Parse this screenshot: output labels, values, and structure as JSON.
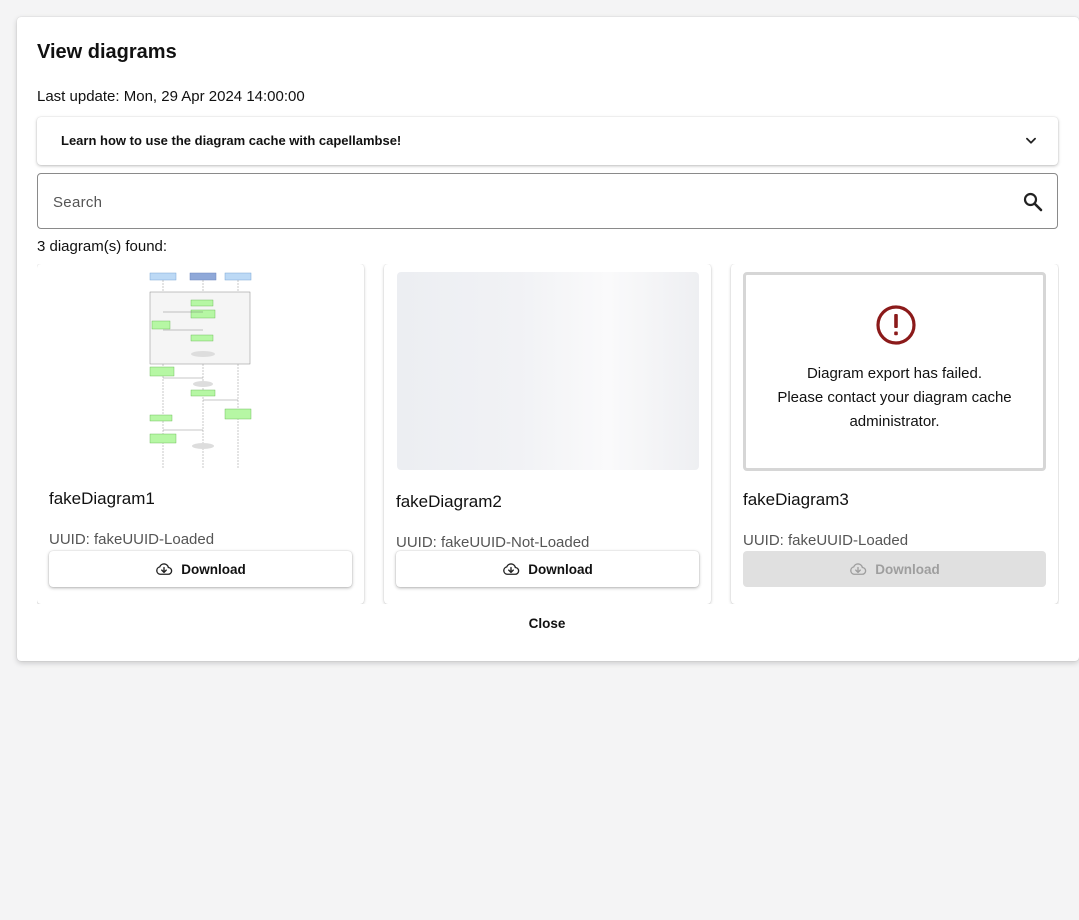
{
  "dialog": {
    "title": "View diagrams",
    "last_update": "Last update: Mon, 29 Apr 2024 14:00:00",
    "accordion_label": "Learn how to use the diagram cache with capellambse!",
    "search_placeholder": "Search",
    "found_text": "3 diagram(s) found:",
    "close_label": "Close"
  },
  "diagrams": [
    {
      "name": "fakeDiagram1",
      "uuid": "UUID: fakeUUID-Loaded",
      "state": "loaded",
      "download_label": "Download"
    },
    {
      "name": "fakeDiagram2",
      "uuid": "UUID: fakeUUID-Not-Loaded",
      "state": "loading",
      "download_label": "Download"
    },
    {
      "name": "fakeDiagram3",
      "uuid": "UUID: fakeUUID-Loaded",
      "state": "failed",
      "download_label": "Download",
      "error_line1": "Diagram export has failed.",
      "error_line2": "Please contact your diagram cache administrator."
    }
  ],
  "colors": {
    "error_red": "#8b1a1a",
    "disabled_bg": "#e0e0e0",
    "thumb_green": "#b6f7a4",
    "thumb_blue": "#bcd9f5"
  },
  "icons": {
    "expand": "chevron-down-icon",
    "search": "search-icon",
    "download": "cloud-download-icon",
    "error": "error-circle-icon"
  }
}
